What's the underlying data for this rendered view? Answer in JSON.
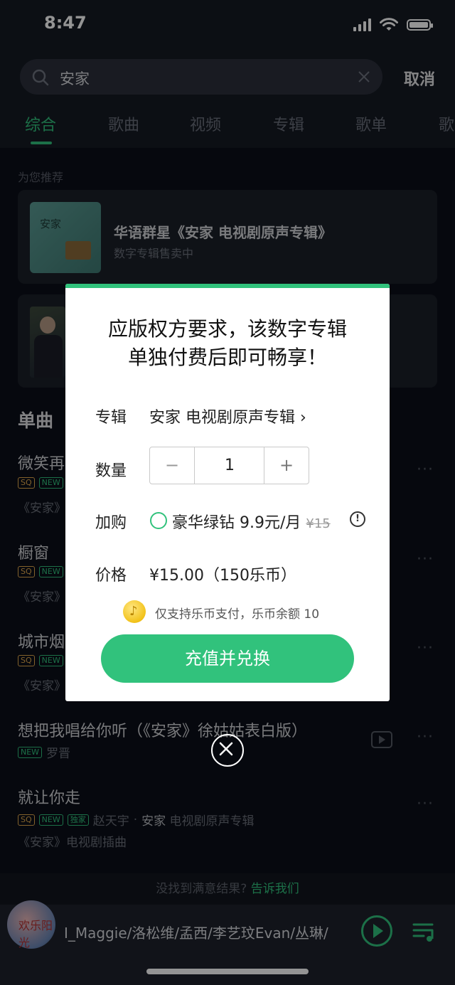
{
  "status_bar": {
    "time": "8:47"
  },
  "search": {
    "query": "安家",
    "cancel_label": "取消"
  },
  "tabs": [
    "综合",
    "歌曲",
    "视频",
    "专辑",
    "歌单",
    "歌"
  ],
  "recommend": {
    "section_label": "为您推荐",
    "album_card": {
      "cover_text": "安家",
      "title": "华语群星《安家 电视剧原声专辑》",
      "subtitle": "数字专辑售卖中"
    }
  },
  "songs": {
    "section_label": "单曲",
    "items": [
      {
        "title": "微笑再",
        "tags": [
          "SQ",
          "NEW"
        ],
        "sub": "《安家》"
      },
      {
        "title": "橱窗",
        "tags": [
          "SQ",
          "NEW"
        ],
        "sub": "《安家》"
      },
      {
        "title": "城市烟",
        "tags": [
          "SQ",
          "NEW"
        ],
        "sub": "《安家》"
      },
      {
        "title": "想把我唱给你听（《安家》徐姑姑表白版）",
        "tags": [
          "NEW"
        ],
        "artist": "罗晋"
      },
      {
        "title": "就让你走",
        "tags": [
          "SQ",
          "NEW",
          "独家"
        ],
        "artist": "赵天宇",
        "separator": "·",
        "album_highlight": "安家",
        "album_rest": " 电视剧原声专辑",
        "sub": "《安家》电视剧插曲"
      }
    ],
    "more_icon": "···"
  },
  "feedback": {
    "text": "没找到满意结果?",
    "link": "告诉我们"
  },
  "player": {
    "cover_text": "欢乐阳光",
    "now_playing": "Ⅰ_Maggie/洛松维/孟西/李艺玟Evan/丛琳/"
  },
  "modal": {
    "title_line1": "应版权方要求，该数字专辑",
    "title_line2": "单独付费后即可畅享！",
    "album_label": "专辑",
    "album_value": "安家 电视剧原声专辑",
    "album_chevron": "›",
    "qty_label": "数量",
    "qty_minus": "−",
    "qty_value": "1",
    "qty_plus": "+",
    "addon_label": "加购",
    "addon_text": "豪华绿钻 9.9元/月",
    "addon_original": "¥15",
    "addon_info": "!",
    "price_label": "价格",
    "price_value": "¥15.00（150乐币）",
    "coin_glyph": "♪",
    "coin_note": "仅支持乐币支付，乐币余额 10",
    "cta_label": "充值并兑换"
  },
  "colors": {
    "accent": "#31c27c",
    "background": "#161a24",
    "list_background": "#0c0f19"
  }
}
